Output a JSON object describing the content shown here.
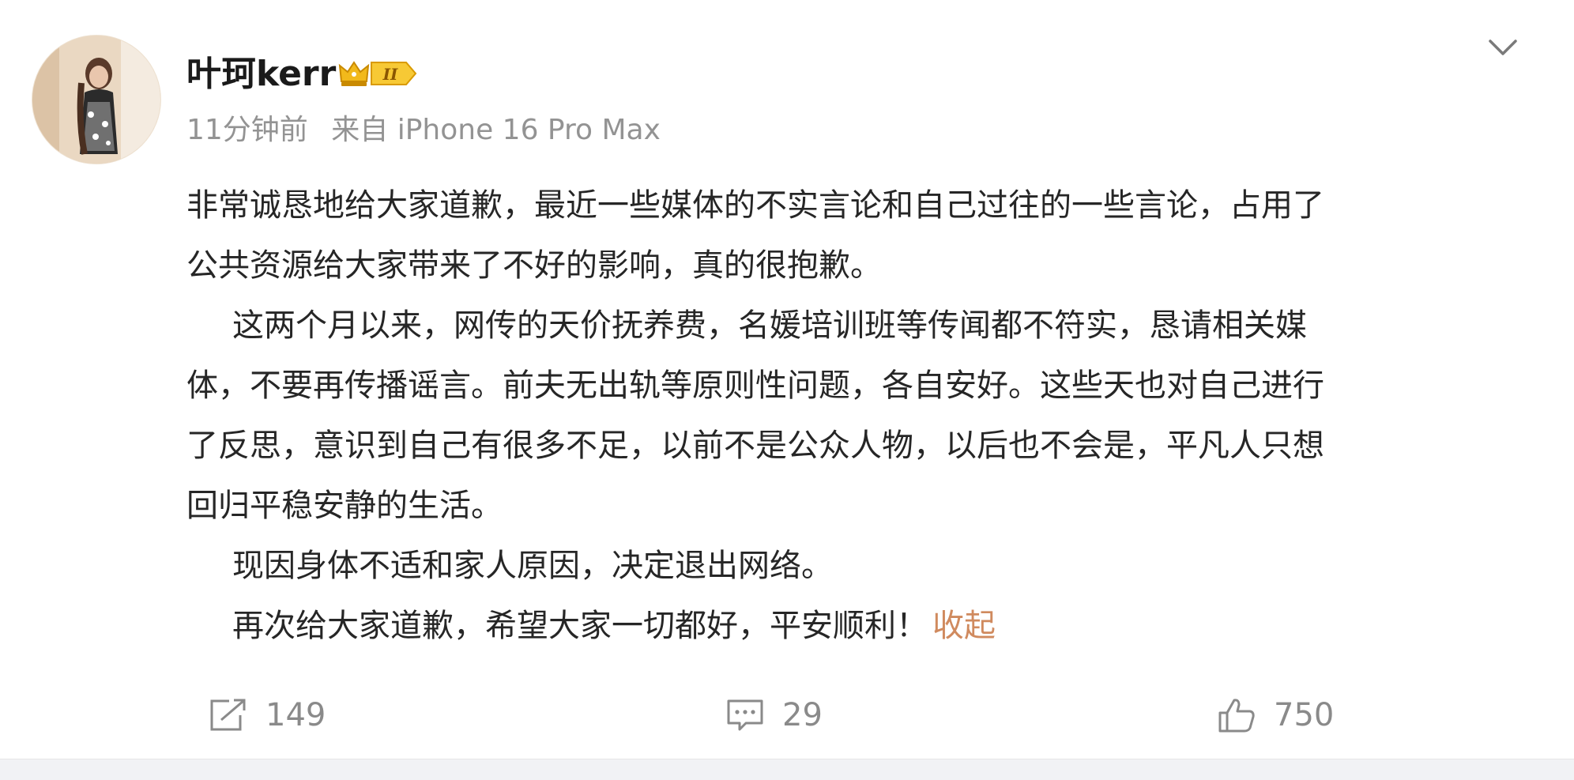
{
  "post": {
    "author": {
      "name": "叶珂kerr",
      "level_badge": "II"
    },
    "meta": {
      "time": "11分钟前",
      "source": "来自 iPhone 16 Pro Max"
    },
    "paragraphs": [
      "非常诚恳地给大家道歉，最近一些媒体的不实言论和自己过往的一些言论，占用了",
      "公共资源给大家带来了不好的影响，真的很抱歉。",
      "这两个月以来，网传的天价抚养费，名媛培训班等传闻都不符实，恳请相关媒",
      "体，不要再传播谣言。前夫无出轨等原则性问题，各自安好。这些天也对自己进行",
      "了反思，意识到自己有很多不足，以前不是公众人物，以后也不会是，平凡人只想",
      "回归平稳安静的生活。",
      "现因身体不适和家人原因，决定退出网络。",
      "再次给大家道歉，希望大家一切都好，平安顺利！"
    ],
    "collapse_label": "收起",
    "actions": {
      "share_count": "149",
      "comment_count": "29",
      "like_count": "750"
    }
  },
  "colors": {
    "link": "#d08a5e",
    "meta_text": "#939393",
    "body_text": "#262626",
    "badge_gold": "#f2b91b"
  },
  "icons": {
    "more": "chevron-down-icon",
    "share": "share-icon",
    "comment": "comment-icon",
    "like": "thumbs-up-icon",
    "crown": "crown-icon"
  }
}
